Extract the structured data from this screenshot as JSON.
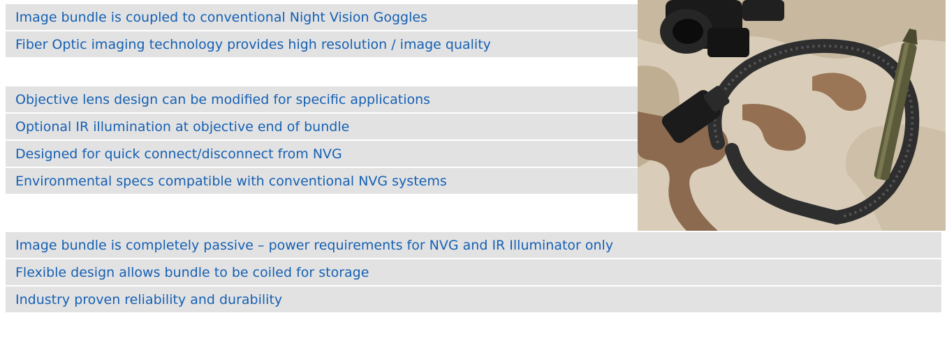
{
  "bullets": [
    "Image bundle is coupled to conventional Night Vision Goggles",
    "Fiber Optic imaging technology provides high resolution / image quality",
    "Objective lens design can be modified for specific applications",
    "Optional IR illumination at objective end of bundle",
    "Designed for quick connect/disconnect from NVG",
    "Environmental specs compatible with conventional NVG systems",
    "Image bundle is completely passive – power requirements for NVG and IR Illuminator only",
    "Flexible design allows bundle to be coiled for storage",
    "Industry proven reliability and durability"
  ],
  "colors": {
    "row_background": "#e2e2e2",
    "text": "#1560b4"
  },
  "photo": {
    "subject": "fiber-optic-image-bundle-photo"
  }
}
